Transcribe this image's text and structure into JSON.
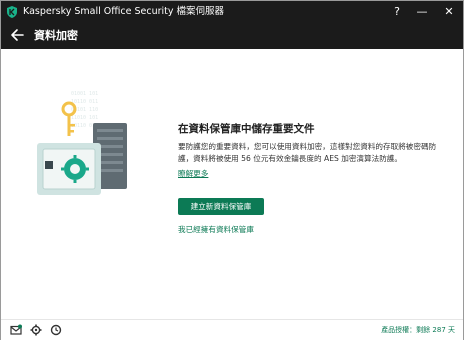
{
  "window": {
    "title": "Kaspersky Small Office Security 檔案伺服器",
    "help_label": "?",
    "minimize_label": "—",
    "close_label": "✕"
  },
  "header": {
    "title": "資料加密"
  },
  "main": {
    "heading": "在資料保管庫中儲存重要文件",
    "description": "要防護您的重要資料，您可以使用資料加密，這樣對您資料的存取將被密碼防護，資料將被使用 56 位元有效金鑰長度的 AES 加密演算法防護。",
    "learn_more": "瞭解更多",
    "create_button": "建立新資料保管庫",
    "have_vault_link": "我已經擁有資料保管庫"
  },
  "footer": {
    "license_text": "產品授權：剩餘 287 天"
  },
  "colors": {
    "titlebar": "#1b1b1b",
    "accent": "#0c7a55"
  }
}
